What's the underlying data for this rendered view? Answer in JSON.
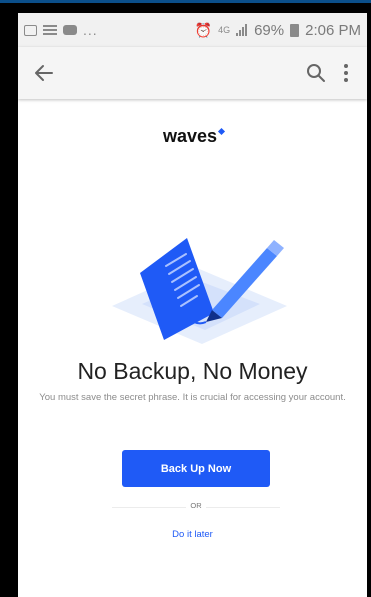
{
  "status_bar": {
    "left_icons": [
      "gallery-icon",
      "list-icon",
      "video-icon"
    ],
    "ellipsis": "...",
    "network": "4G",
    "battery": "69%",
    "time": "2:06 PM"
  },
  "app_bar": {
    "icons": [
      "back-arrow-icon",
      "search-icon",
      "more-vertical-icon"
    ]
  },
  "brand": {
    "name": "waves",
    "accent_color": "#1f5af6"
  },
  "main": {
    "headline": "No Backup, No Money",
    "description": "You must save the secret phrase. It is crucial for accessing your account.",
    "primary_button": "Back Up Now",
    "divider_text": "OR",
    "secondary_link": "Do it later"
  }
}
